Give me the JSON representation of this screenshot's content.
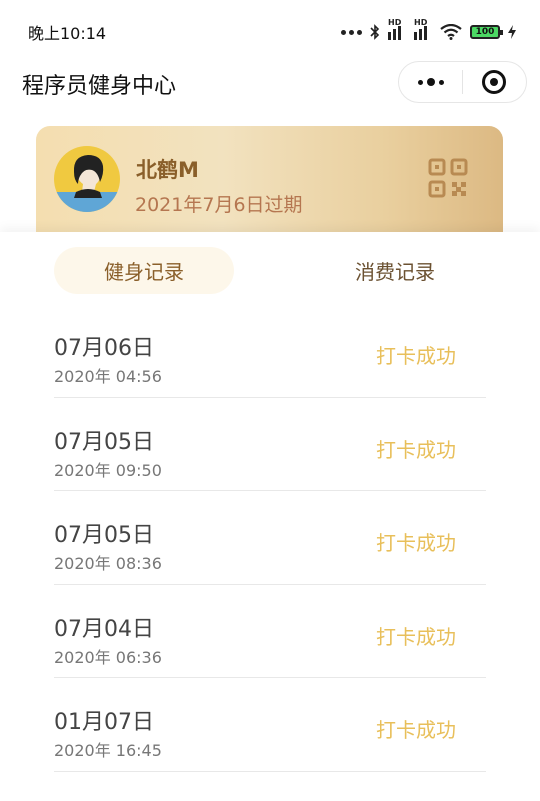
{
  "status_bar": {
    "time": "晚上10:14",
    "signal_hd_1": "HD",
    "signal_hd_2": "HD",
    "battery": "100",
    "icons": [
      "dots-icon",
      "bluetooth-icon",
      "signal-icon",
      "signal-icon",
      "wifi-icon",
      "battery-icon",
      "charging-icon"
    ]
  },
  "header": {
    "title": "程序员健身中心"
  },
  "card": {
    "name": "北鹤M",
    "expiry": "2021年7月6日过期",
    "colors": {
      "name": "#8a5f2a",
      "expiry": "#b57650"
    }
  },
  "tabs": [
    {
      "label": "健身记录",
      "active": true
    },
    {
      "label": "消费记录",
      "active": false
    }
  ],
  "records": [
    {
      "date": "07月06日",
      "time": "2020年 04:56",
      "status": "打卡成功"
    },
    {
      "date": "07月05日",
      "time": "2020年 09:50",
      "status": "打卡成功"
    },
    {
      "date": "07月05日",
      "time": "2020年 08:36",
      "status": "打卡成功"
    },
    {
      "date": "07月04日",
      "time": "2020年 06:36",
      "status": "打卡成功"
    },
    {
      "date": "01月07日",
      "time": "2020年 16:45",
      "status": "打卡成功"
    }
  ],
  "accent": "#e8bf5a"
}
